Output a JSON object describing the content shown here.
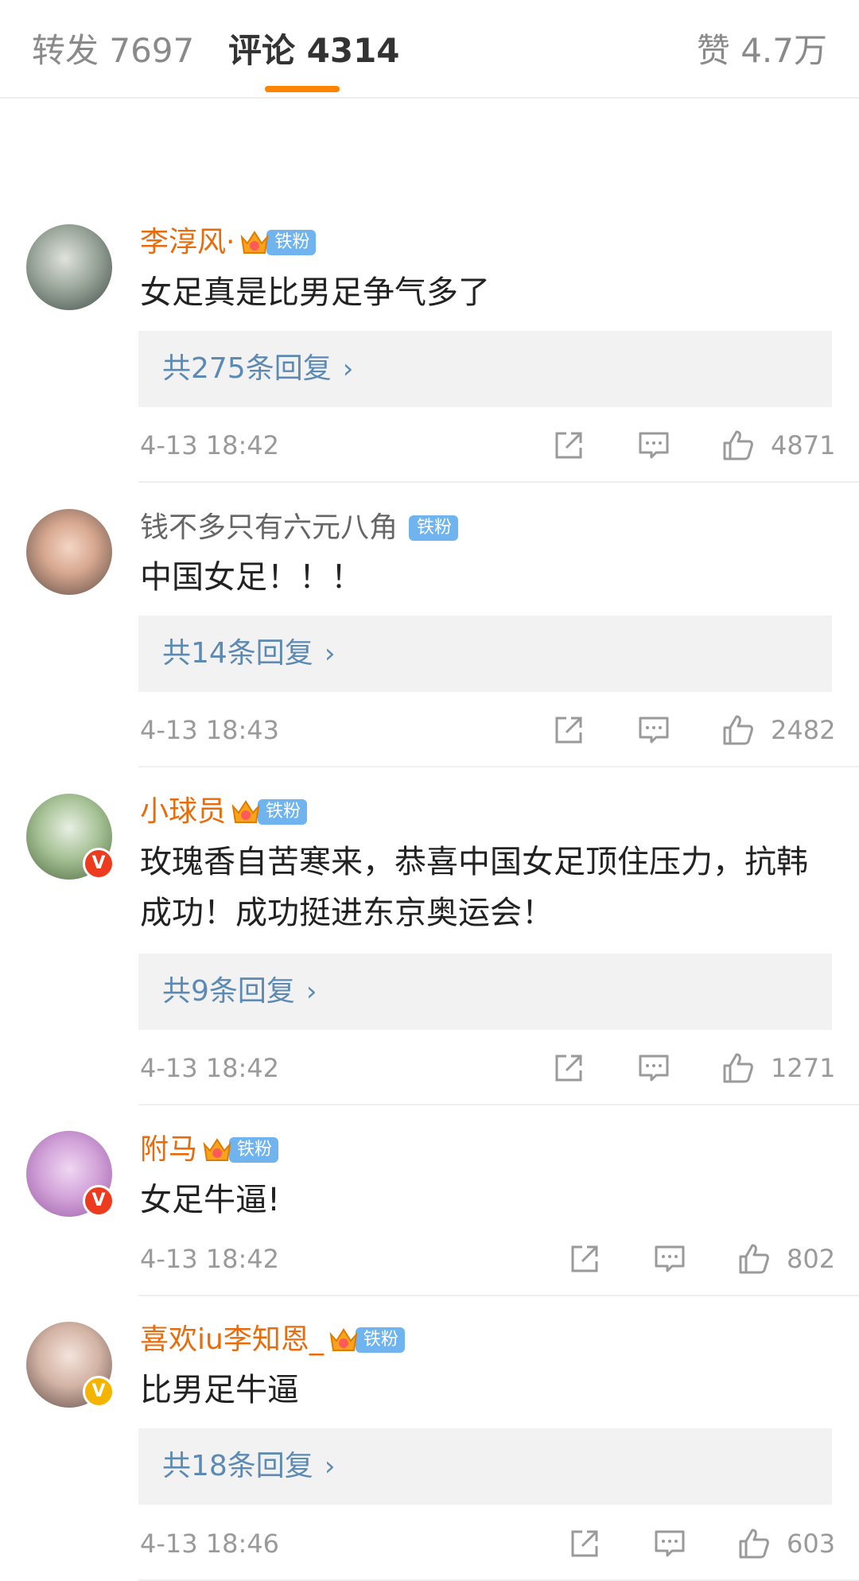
{
  "tabs": {
    "repost": "转发 7697",
    "comment": "评论 4314",
    "like": "赞 4.7万"
  },
  "colors": {
    "accent": "#ff8200",
    "orange_name": "#e86b0c",
    "reply_link": "#5d8ab3",
    "fan_badge": "#6fb3ef",
    "verified_red": "#ec3b1e",
    "verified_gold": "#f5b400"
  },
  "comments": [
    {
      "username": "李淳风·",
      "fan_badge": "铁粉",
      "text": "女足真是比男足争气多了",
      "reply_label": "共275条回复",
      "time": "4-13 18:42",
      "likes": "4871"
    },
    {
      "username": "钱不多只有六元八角",
      "fan_badge": "铁粉",
      "text": "中国女足！！！",
      "reply_label": "共14条回复",
      "time": "4-13 18:43",
      "likes": "2482"
    },
    {
      "username": "小球员",
      "fan_badge": "铁粉",
      "verified": "V",
      "text": "玫瑰香自苦寒来，恭喜中国女足顶住压力，抗韩成功！成功挺进东京奥运会！",
      "reply_label": "共9条回复",
      "time": "4-13 18:42",
      "likes": "1271"
    },
    {
      "username": "附马",
      "fan_badge": "铁粉",
      "verified": "V",
      "text": "女足牛逼!",
      "time": "4-13 18:42",
      "likes": "802"
    },
    {
      "username": "喜欢iu李知恩_",
      "fan_badge": "铁粉",
      "verified": "V",
      "text": "比男足牛逼",
      "reply_label": "共18条回复",
      "time": "4-13 18:46",
      "likes": "603"
    }
  ],
  "icons": {
    "repost": "share-icon",
    "comment": "comment-icon",
    "like": "thumbs-up-icon",
    "reply_arrow": "chevron-right-icon"
  }
}
